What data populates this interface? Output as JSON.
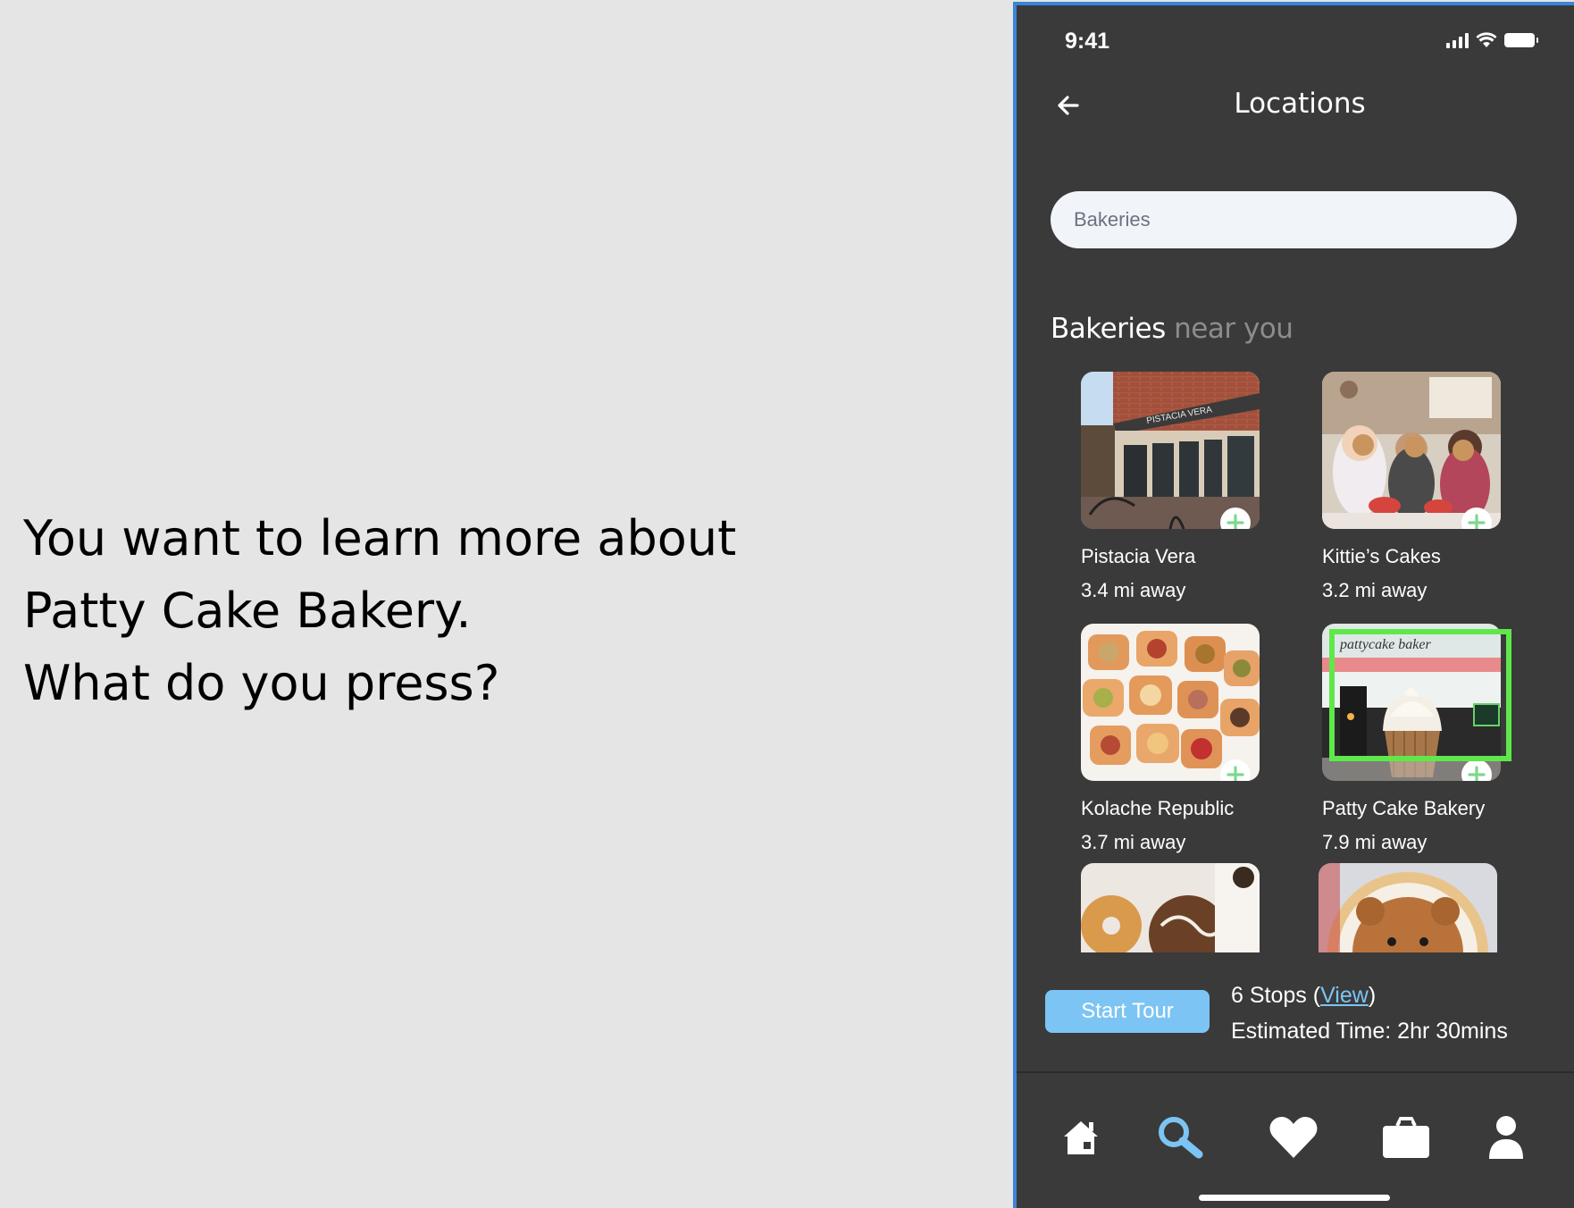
{
  "prompt": {
    "lines": [
      "You want to learn more about",
      "Patty Cake Bakery.",
      "What do you press?"
    ]
  },
  "status_bar": {
    "time": "9:41"
  },
  "header": {
    "title": "Locations"
  },
  "search": {
    "value": "Bakeries",
    "placeholder": "Bakeries"
  },
  "section": {
    "title_strong": "Bakeries",
    "title_muted": "near you"
  },
  "bakeries": [
    {
      "name": "Pistacia Vera",
      "distance": "3.4 mi away",
      "sign_text": "PISTACIA VERA"
    },
    {
      "name": "Kittie’s Cakes",
      "distance": "3.2 mi away"
    },
    {
      "name": "Kolache Republic",
      "distance": "3.7 mi away"
    },
    {
      "name": "Patty Cake Bakery",
      "distance": "7.9 mi away",
      "highlighted": true,
      "sign_text": "pattycake baker"
    }
  ],
  "tour": {
    "button_label": "Start Tour",
    "stops_text": "6 Stops (",
    "view_label": "View",
    "stops_close": ")",
    "estimated_time": "Estimated Time: 2hr 30mins"
  },
  "tabs": [
    "home-icon",
    "search-icon",
    "heart-icon",
    "briefcase-icon",
    "profile-icon"
  ],
  "colors": {
    "phone_bg": "#3a3a3a",
    "accent_blue": "#7cc4f4",
    "highlight_green": "#5fe84a",
    "frame_blue": "#3c84d6"
  }
}
